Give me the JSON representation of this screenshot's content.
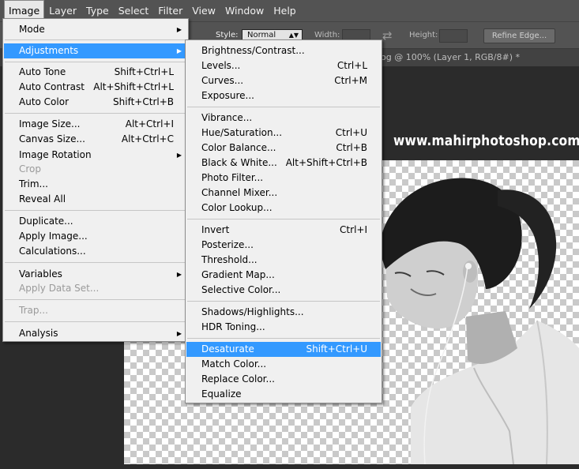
{
  "menubar": {
    "items": [
      "Image",
      "Layer",
      "Type",
      "Select",
      "Filter",
      "View",
      "Window",
      "Help"
    ]
  },
  "options": {
    "frag": "s",
    "style_label": "Style:",
    "style_value": "Normal",
    "width_label": "Width:",
    "height_label": "Height:",
    "refine_label": "Refine Edge..."
  },
  "document_tab": "og @ 100% (Layer 1, RGB/8#) *",
  "watermark": "www.mahirphotoshop.com",
  "image_menu": [
    {
      "label": "Mode",
      "submenu": true
    },
    {
      "label": "Adjustments",
      "submenu": true,
      "highlighted": true
    },
    {
      "label": "Auto Tone",
      "shortcut": "Shift+Ctrl+L"
    },
    {
      "label": "Auto Contrast",
      "shortcut": "Alt+Shift+Ctrl+L"
    },
    {
      "label": "Auto Color",
      "shortcut": "Shift+Ctrl+B"
    },
    {
      "label": "Image Size...",
      "shortcut": "Alt+Ctrl+I"
    },
    {
      "label": "Canvas Size...",
      "shortcut": "Alt+Ctrl+C"
    },
    {
      "label": "Image Rotation",
      "submenu": true
    },
    {
      "label": "Crop",
      "disabled": true
    },
    {
      "label": "Trim..."
    },
    {
      "label": "Reveal All"
    },
    {
      "label": "Duplicate..."
    },
    {
      "label": "Apply Image..."
    },
    {
      "label": "Calculations..."
    },
    {
      "label": "Variables",
      "submenu": true
    },
    {
      "label": "Apply Data Set...",
      "disabled": true
    },
    {
      "label": "Trap...",
      "disabled": true
    },
    {
      "label": "Analysis",
      "submenu": true
    }
  ],
  "adjustments_menu": [
    {
      "label": "Brightness/Contrast..."
    },
    {
      "label": "Levels...",
      "shortcut": "Ctrl+L"
    },
    {
      "label": "Curves...",
      "shortcut": "Ctrl+M"
    },
    {
      "label": "Exposure..."
    },
    {
      "label": "Vibrance..."
    },
    {
      "label": "Hue/Saturation...",
      "shortcut": "Ctrl+U"
    },
    {
      "label": "Color Balance...",
      "shortcut": "Ctrl+B"
    },
    {
      "label": "Black & White...",
      "shortcut": "Alt+Shift+Ctrl+B"
    },
    {
      "label": "Photo Filter..."
    },
    {
      "label": "Channel Mixer..."
    },
    {
      "label": "Color Lookup..."
    },
    {
      "label": "Invert",
      "shortcut": "Ctrl+I"
    },
    {
      "label": "Posterize..."
    },
    {
      "label": "Threshold..."
    },
    {
      "label": "Gradient Map..."
    },
    {
      "label": "Selective Color..."
    },
    {
      "label": "Shadows/Highlights..."
    },
    {
      "label": "HDR Toning..."
    },
    {
      "label": "Desaturate",
      "shortcut": "Shift+Ctrl+U",
      "highlighted": true
    },
    {
      "label": "Match Color..."
    },
    {
      "label": "Replace Color..."
    },
    {
      "label": "Equalize"
    }
  ],
  "colors": {
    "menubar_bg": "#535353",
    "menu_bg": "#f0f0f0",
    "highlight": "#3399ff",
    "disabled_text": "#9a9a9a"
  }
}
